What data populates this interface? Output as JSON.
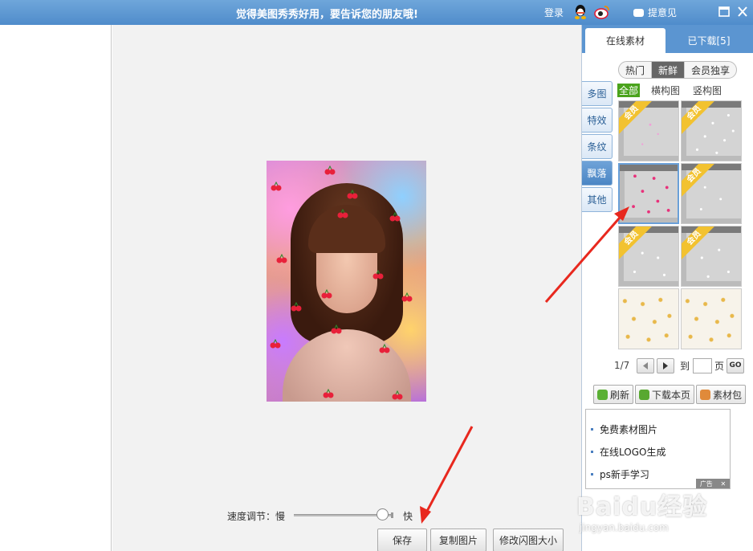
{
  "titlebar": {
    "banner": "觉得美图秀秀好用，要告诉您的朋友哦!",
    "login": "登录",
    "feedback": "提意见"
  },
  "canvas": {
    "speed_label": "速度调节：慢",
    "speed_fast": "快",
    "speed_level": 0.88,
    "buttons": {
      "save": "保存",
      "copy": "复制图片",
      "resize": "修改闪图大小"
    }
  },
  "panel": {
    "tabs": {
      "online": "在线素材",
      "downloaded": "已下载[5]"
    },
    "subtabs": [
      "热门",
      "新鲜",
      "会员独享"
    ],
    "subtab_selected": "新鲜",
    "filters": [
      "全部",
      "横构图",
      "竖构图"
    ],
    "filter_selected": "全部",
    "categories": [
      "多图",
      "特效",
      "条纹",
      "飘落",
      "其他"
    ],
    "category_selected": "飘落",
    "vip_badge": "会员",
    "pager": {
      "page": "1/7",
      "to": "到",
      "unit": "页",
      "go": "GO"
    },
    "tools": {
      "refresh": "刷新",
      "download_page": "下载本页",
      "pack": "素材包"
    },
    "links": [
      "免费素材图片",
      "在线LOGO生成",
      "ps新手学习"
    ],
    "ad_label": "广告"
  },
  "watermark": {
    "logo": "Baidu经验",
    "url": "jingyan.baidu.com"
  },
  "colors": {
    "titlebar": "#5b95d1",
    "accent": "#4aa31c",
    "vip": "#f2c230",
    "arrow": "#e8281e"
  }
}
